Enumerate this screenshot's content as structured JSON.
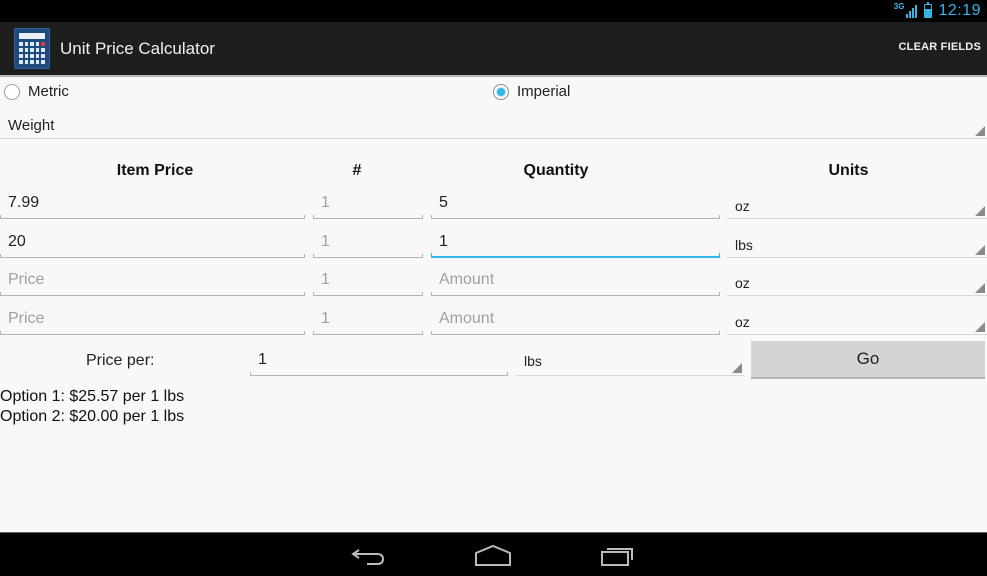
{
  "status_bar": {
    "network_type": "3G",
    "time": "12:19"
  },
  "action_bar": {
    "app_icon": "calculator-icon",
    "title": "Unit Price Calculator",
    "clear_fields_label": "CLEAR FIELDS"
  },
  "system": {
    "radio_options": [
      {
        "label": "Metric",
        "checked": false
      },
      {
        "label": "Imperial",
        "checked": true
      }
    ]
  },
  "measure_type": {
    "selected": "Weight"
  },
  "table": {
    "headers": {
      "item_price": "Item Price",
      "count": "#",
      "quantity": "Quantity",
      "units": "Units"
    },
    "rows": [
      {
        "price": "7.99",
        "price_placeholder": "Price",
        "count": "",
        "count_placeholder": "1",
        "quantity": "5",
        "quantity_placeholder": "Amount",
        "unit": "oz",
        "focused": false
      },
      {
        "price": "20",
        "price_placeholder": "Price",
        "count": "",
        "count_placeholder": "1",
        "quantity": "1",
        "quantity_placeholder": "Amount",
        "unit": "lbs",
        "focused": true
      },
      {
        "price": "",
        "price_placeholder": "Price",
        "count": "",
        "count_placeholder": "1",
        "quantity": "",
        "quantity_placeholder": "Amount",
        "unit": "oz",
        "focused": false
      },
      {
        "price": "",
        "price_placeholder": "Price",
        "count": "",
        "count_placeholder": "1",
        "quantity": "",
        "quantity_placeholder": "Amount",
        "unit": "oz",
        "focused": false
      }
    ]
  },
  "price_per": {
    "label": "Price per:",
    "amount": "1",
    "unit": "lbs",
    "go_label": "Go"
  },
  "results": [
    "Option 1: $25.57 per 1 lbs",
    "Option 2: $20.00 per 1 lbs"
  ],
  "nav_bar": {
    "buttons": [
      "back-icon",
      "home-icon",
      "recent-apps-icon"
    ]
  },
  "colors": {
    "accent": "#33b5e5",
    "action_bar": "#1e1e1e",
    "background": "#f8f8f8"
  }
}
